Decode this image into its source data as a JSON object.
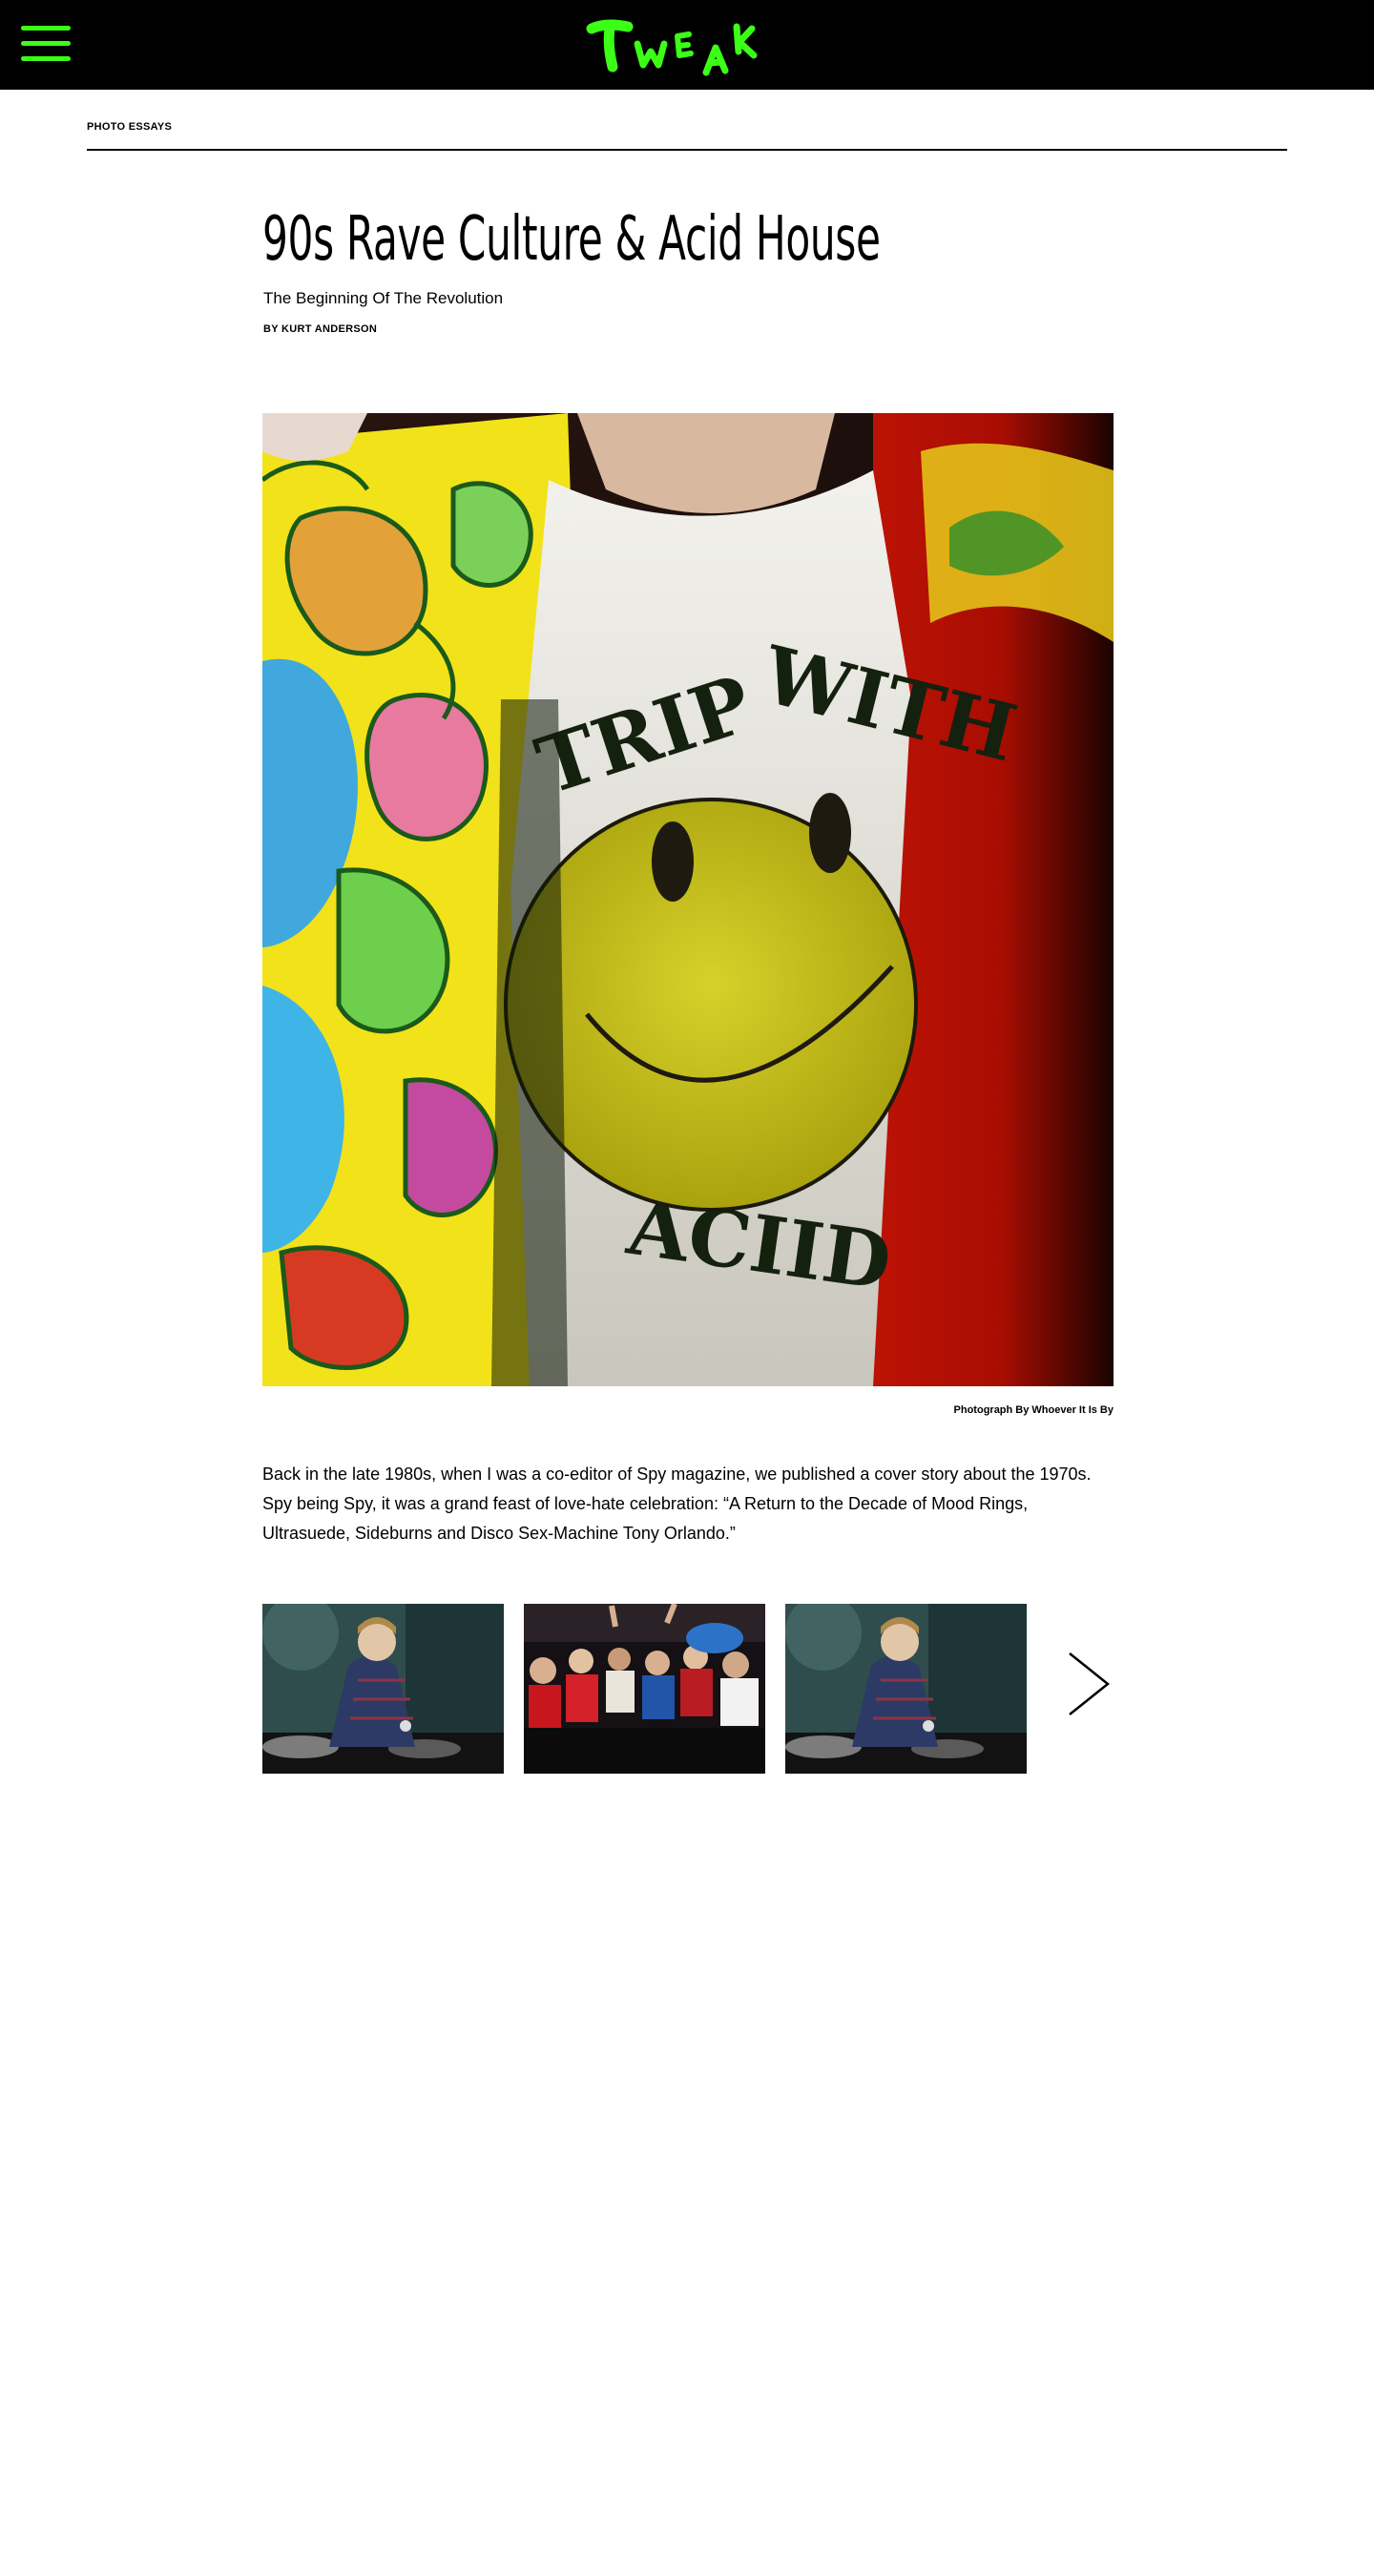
{
  "site": {
    "logo_text": "TWEAK",
    "logo_color": "#3cff17",
    "header_bg": "#000000",
    "menu_icon": "hamburger-menu-icon"
  },
  "section": {
    "label": "PHOTO ESSAYS"
  },
  "article": {
    "title": "90s Rave Culture & Acid House",
    "subtitle": "The Beginning Of The Revolution",
    "byline": "BY KURT ANDERSON",
    "hero_shirt_top": "TRIP WITH",
    "hero_shirt_bottom": "ACIID",
    "hero_caption": "Photograph By Whoever It Is By",
    "body": "Back in the late 1980s, when I was a co-editor of Spy magazine, we published a cover story about the 1970s. Spy being Spy, it was a grand feast of love-hate celebration: “A Return to the Decade of Mood Rings, Ultrasuede, Sideburns and Disco Sex-Machine Tony Orlando.”"
  },
  "gallery": {
    "next_icon": "chevron-right-icon",
    "thumbs": [
      "dj-at-turntables-photo",
      "crowd-dancing-photo",
      "dj-at-turntables-photo"
    ]
  }
}
